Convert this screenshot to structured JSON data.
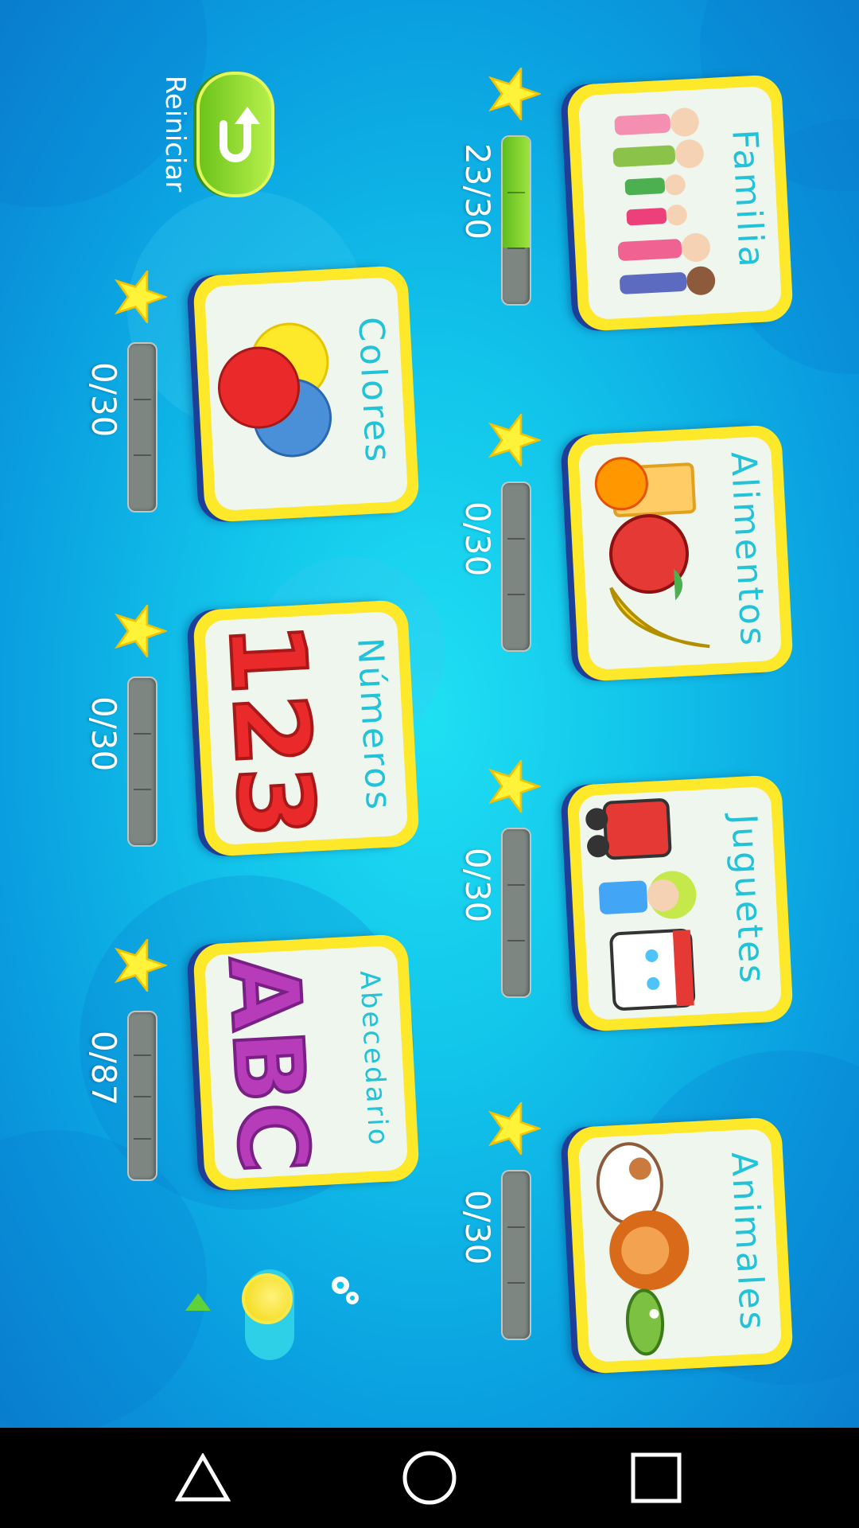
{
  "categories": [
    {
      "id": "familia",
      "label": "Familia",
      "progress": "23/30",
      "done": 23,
      "total": 30
    },
    {
      "id": "alimentos",
      "label": "Alimentos",
      "progress": "0/30",
      "done": 0,
      "total": 30
    },
    {
      "id": "juguetes",
      "label": "Juguetes",
      "progress": "0/30",
      "done": 0,
      "total": 30
    },
    {
      "id": "animales",
      "label": "Animales",
      "progress": "0/30",
      "done": 0,
      "total": 30
    },
    {
      "id": "colores",
      "label": "Colores",
      "progress": "0/30",
      "done": 0,
      "total": 30
    },
    {
      "id": "numeros",
      "label": "Números",
      "progress": "0/30",
      "done": 0,
      "total": 30
    },
    {
      "id": "abecedario",
      "label": "Abecedario",
      "progress": "0/87",
      "done": 0,
      "total": 87
    }
  ],
  "reset": {
    "label": "Reiniciar"
  },
  "settings": {
    "icon": "gear-icon"
  },
  "sound": {
    "icon": "sound-toggle",
    "on": true
  },
  "navbar": {
    "back": "back-triangle-icon",
    "home": "home-circle-icon",
    "recents": "recents-square-icon"
  },
  "colors": {
    "accent": "#fde82a",
    "label": "#22c2d8",
    "progress": "#6cc41c",
    "background": "#12c4ea"
  }
}
